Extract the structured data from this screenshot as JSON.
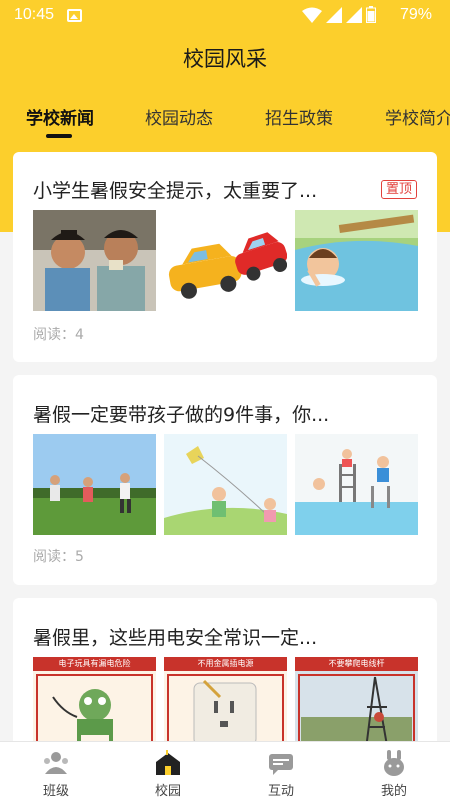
{
  "status_bar": {
    "time": "10:45",
    "battery": "79%"
  },
  "header": {
    "title": "校园风采"
  },
  "tabs": [
    {
      "label": "学校新闻",
      "active": true
    },
    {
      "label": "校园动态"
    },
    {
      "label": "招生政策"
    },
    {
      "label": "学校简介"
    }
  ],
  "articles": [
    {
      "title": "小学生暑假安全提示，太重要了...",
      "badge": "置顶",
      "reads": "阅读：4",
      "images": [
        "boys-eating",
        "car-crash",
        "drowning-child"
      ]
    },
    {
      "title": "暑假一定要带孩子做的9件事，你...",
      "reads": "阅读：5",
      "images": [
        "kids-running",
        "kite-flying",
        "swimming-pool"
      ]
    },
    {
      "title": "暑假里，这些用电安全常识一定...",
      "images": [
        "electric-toy",
        "power-socket",
        "power-tower"
      ],
      "image_captions": [
        "电子玩具有漏电危险",
        "不用金属插电源",
        "不要攀爬电线杆"
      ]
    }
  ],
  "bottom_nav": [
    {
      "label": "班级",
      "icon": "class-icon"
    },
    {
      "label": "校园",
      "icon": "campus-icon",
      "active": true
    },
    {
      "label": "互动",
      "icon": "chat-icon"
    },
    {
      "label": "我的",
      "icon": "profile-icon"
    }
  ],
  "colors": {
    "brand_yellow": "#fccf2c",
    "badge_red": "#e2413c"
  }
}
